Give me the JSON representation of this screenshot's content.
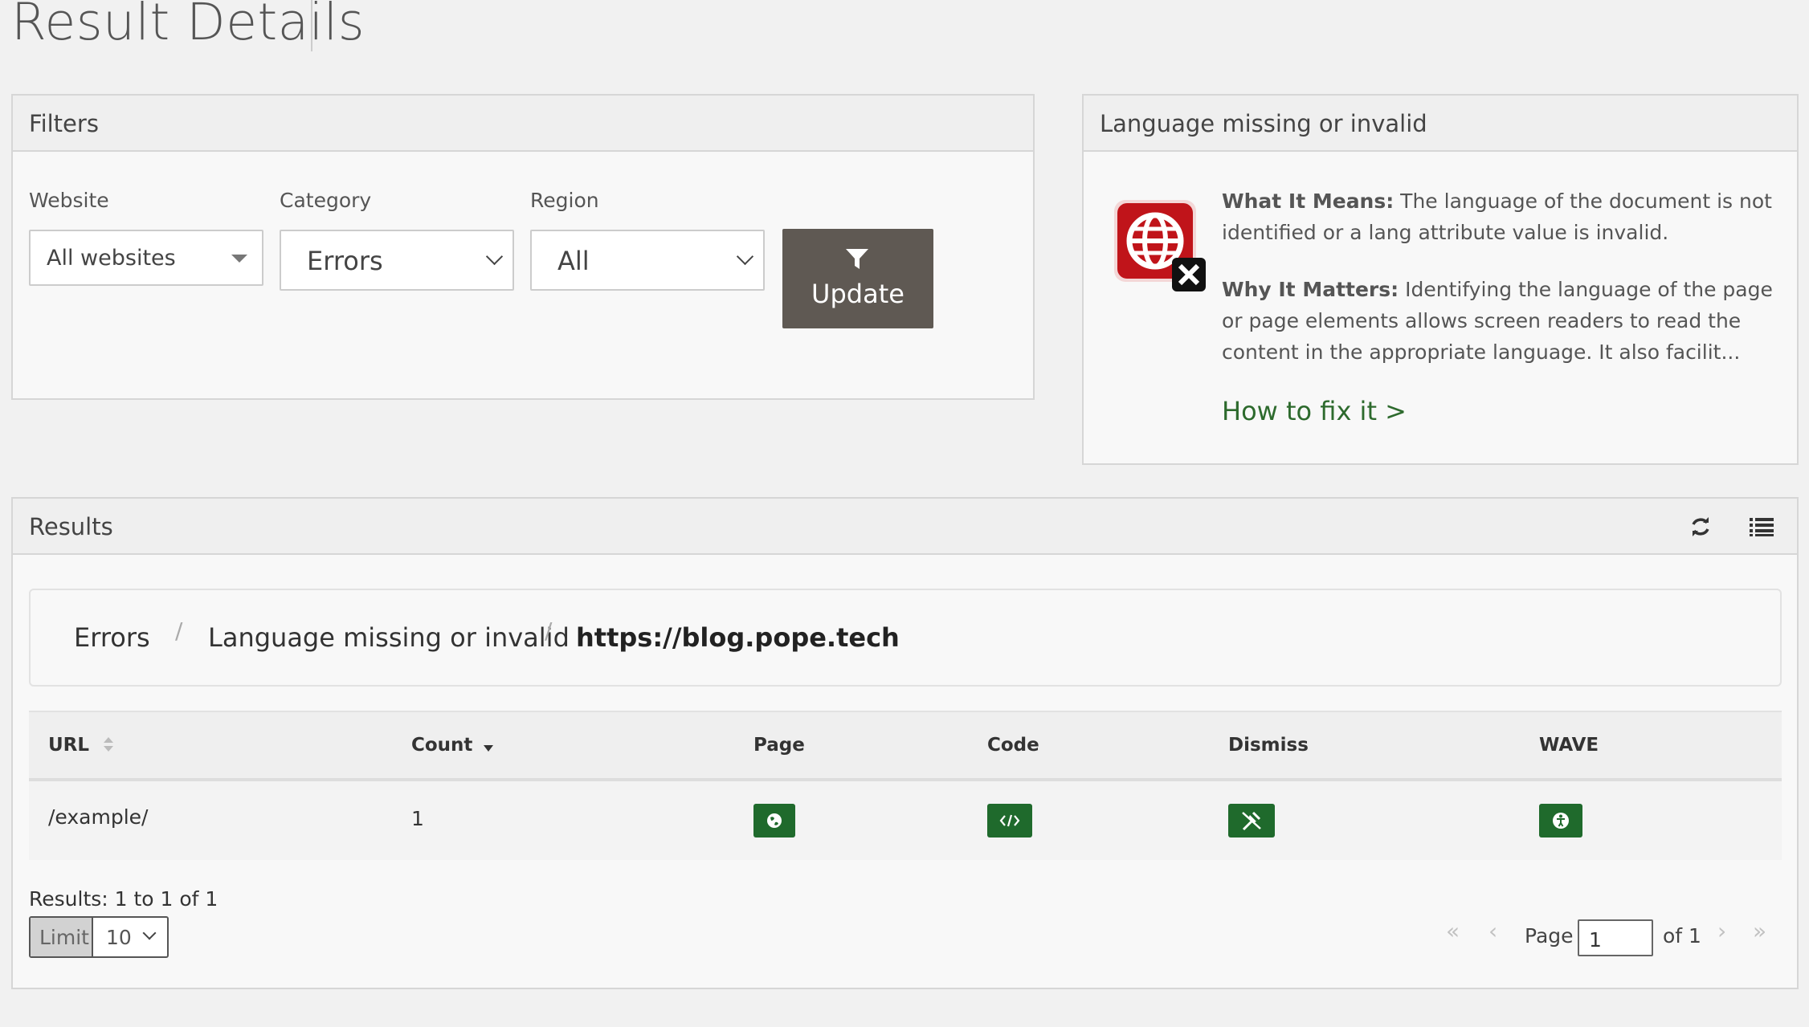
{
  "page": {
    "title": "Result Details"
  },
  "filters": {
    "heading": "Filters",
    "website": {
      "label": "Website",
      "value": "All websites"
    },
    "category": {
      "label": "Category",
      "value": "Errors"
    },
    "region": {
      "label": "Region",
      "value": "All"
    },
    "update_label": "Update"
  },
  "info": {
    "heading": "Language missing or invalid",
    "what_label": "What It Means:",
    "what_text": " The language of the document is not identified or a lang attribute value is invalid.",
    "why_label": "Why It Matters:",
    "why_text": " Identifying the language of the page or page elements allows screen readers to read the content in the appropriate language. It also facilit...",
    "fix_link": "How to fix it >"
  },
  "results": {
    "heading": "Results",
    "breadcrumb": [
      "Errors",
      "Language missing or invalid",
      "https://blog.pope.tech"
    ],
    "columns": [
      "URL",
      "Count",
      "Page",
      "Code",
      "Dismiss",
      "WAVE"
    ],
    "rows": [
      {
        "url": "/example/",
        "count": "1"
      }
    ],
    "summary": "Results: 1 to 1 of 1",
    "limit_label": "Limit",
    "limit_value": "10",
    "page_label": "Page",
    "page_value": "1",
    "page_of": "of 1"
  },
  "colors": {
    "accent_green": "#1f6a2c",
    "update_bg": "#5f5953",
    "error_red": "#c0141a"
  }
}
